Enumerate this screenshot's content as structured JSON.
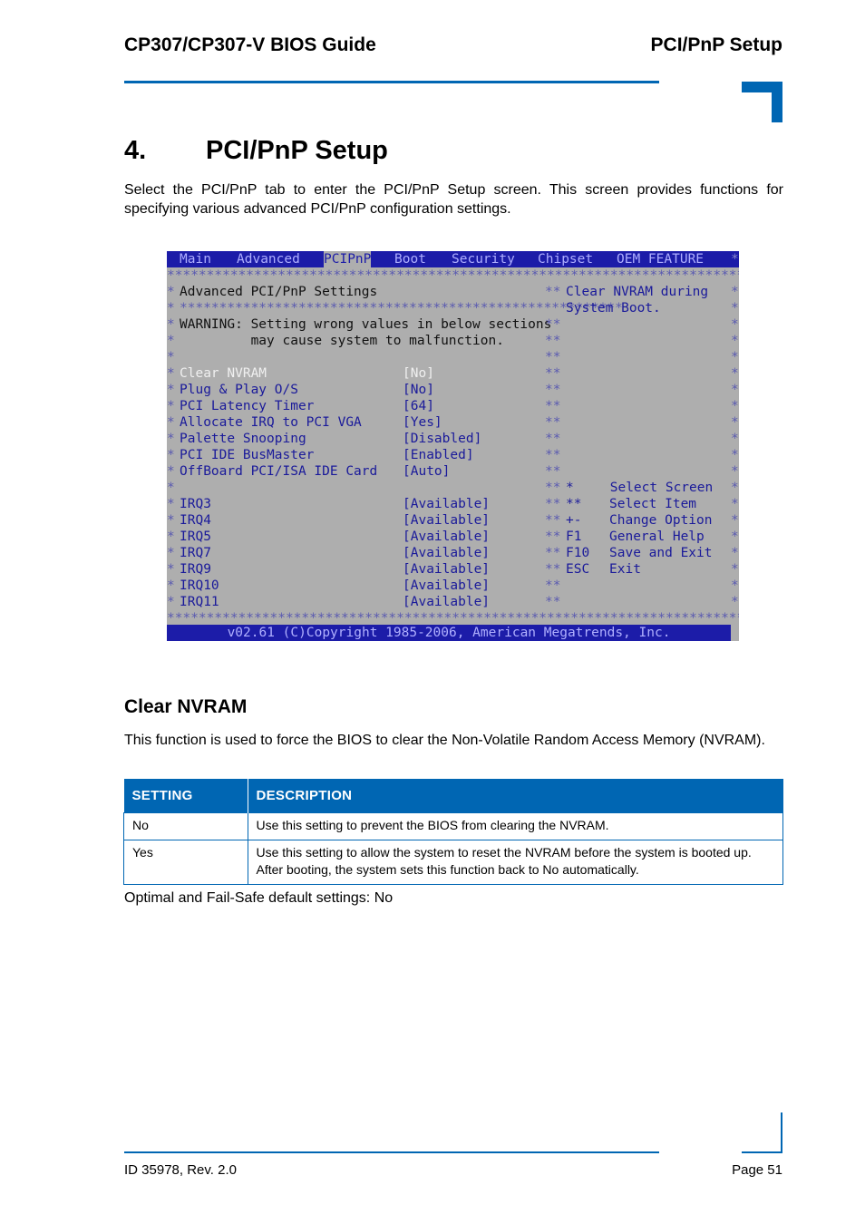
{
  "header": {
    "doc_title": "CP307/CP307-V BIOS Guide",
    "section": "PCI/PnP Setup"
  },
  "chapter": {
    "number": "4.",
    "title": "PCI/PnP Setup",
    "intro": "Select the PCI/PnP tab to enter the PCI/PnP Setup screen. This screen provides functions for specifying various advanced PCI/PnP configuration settings."
  },
  "bios": {
    "tabs": [
      "Main",
      "Advanced",
      "PCIPnP",
      "Boot",
      "Security",
      "Chipset",
      "OEM FEATURE"
    ],
    "active_tab": "PCIPnP",
    "heading": "Advanced PCI/PnP Settings",
    "warning_line1": "WARNING: Setting wrong values in below sections",
    "warning_line2": "         may cause system to malfunction.",
    "help_line1": "Clear NVRAM during",
    "help_line2": "System Boot.",
    "settings": [
      {
        "label": "Clear NVRAM",
        "value": "[No]",
        "selected": true
      },
      {
        "label": "Plug & Play O/S",
        "value": "[No]"
      },
      {
        "label": "PCI Latency Timer",
        "value": "[64]"
      },
      {
        "label": "Allocate IRQ to PCI VGA",
        "value": "[Yes]"
      },
      {
        "label": "Palette Snooping",
        "value": "[Disabled]"
      },
      {
        "label": "PCI IDE BusMaster",
        "value": "[Enabled]"
      },
      {
        "label": "OffBoard PCI/ISA IDE Card",
        "value": "[Auto]"
      }
    ],
    "irqs": [
      {
        "label": "IRQ3",
        "value": "[Available]"
      },
      {
        "label": "IRQ4",
        "value": "[Available]"
      },
      {
        "label": "IRQ5",
        "value": "[Available]"
      },
      {
        "label": "IRQ7",
        "value": "[Available]"
      },
      {
        "label": "IRQ9",
        "value": "[Available]"
      },
      {
        "label": "IRQ10",
        "value": "[Available]"
      },
      {
        "label": "IRQ11",
        "value": "[Available]"
      }
    ],
    "keys": [
      {
        "key": "*",
        "action": " Select Screen"
      },
      {
        "key": "**",
        "action": "Select Item"
      },
      {
        "key": "+-",
        "action": "Change Option"
      },
      {
        "key": "F1",
        "action": "General Help"
      },
      {
        "key": "F10",
        "action": "Save and Exit"
      },
      {
        "key": "ESC",
        "action": "Exit"
      }
    ],
    "footer": "v02.61 (C)Copyright 1985-2006, American Megatrends, Inc."
  },
  "section": {
    "title": "Clear NVRAM",
    "text": "This function is used to force the BIOS to clear the Non-Volatile Random Access Memory (NVRAM).",
    "table": {
      "headers": [
        "SETTING",
        "DESCRIPTION"
      ],
      "rows": [
        {
          "setting": "No",
          "description": "Use this setting to prevent the BIOS from clearing the NVRAM."
        },
        {
          "setting": "Yes",
          "description": "Use this setting to allow the system to reset the NVRAM before the system is booted up. After booting, the system sets this function back to No automatically."
        }
      ]
    },
    "defaults": "Optimal and Fail-Safe default settings: No"
  },
  "footer": {
    "doc_id": "ID 35978, Rev. 2.0",
    "page": "Page 51"
  }
}
